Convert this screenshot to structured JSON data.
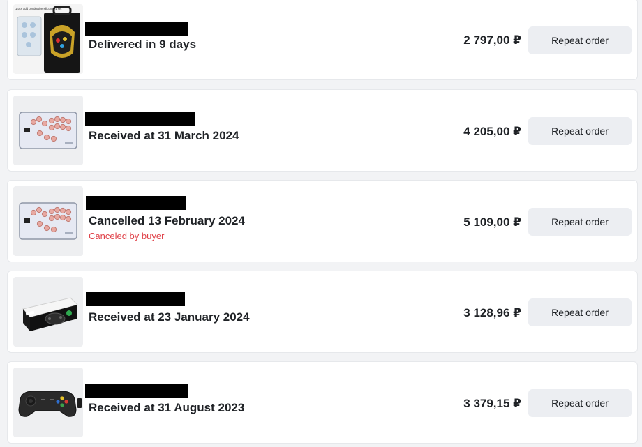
{
  "orders": [
    {
      "status": "Delivered in 9 days",
      "sub_status": "",
      "price": "2 797,00 ₽",
      "button_label": "Repeat order",
      "thumb_icon": "arcade-kit-box-image",
      "thumb_text": "1 pcs add conductive silicone *1 set"
    },
    {
      "status": "Received at 31 March 2024",
      "sub_status": "",
      "price": "4 205,00 ₽",
      "button_label": "Repeat order",
      "thumb_icon": "hitbox-controller-pcb-image",
      "thumb_text": ""
    },
    {
      "status": "Cancelled 13 February 2024",
      "sub_status": "Canceled by buyer",
      "price": "5 109,00 ₽",
      "button_label": "Repeat order",
      "thumb_icon": "hitbox-controller-pcb-image",
      "thumb_text": ""
    },
    {
      "status": "Received at 23 January 2024",
      "sub_status": "",
      "price": "3 128,96 ₽",
      "button_label": "Repeat order",
      "thumb_icon": "gamepad-box-image",
      "thumb_text": ""
    },
    {
      "status": "Received at 31 August 2023",
      "sub_status": "",
      "price": "3 379,15 ₽",
      "button_label": "Repeat order",
      "thumb_icon": "gamepad-image",
      "thumb_text": ""
    }
  ],
  "colors": {
    "cancel_text": "#e0434a",
    "button_bg": "#eceef2",
    "card_bg": "#ffffff"
  }
}
